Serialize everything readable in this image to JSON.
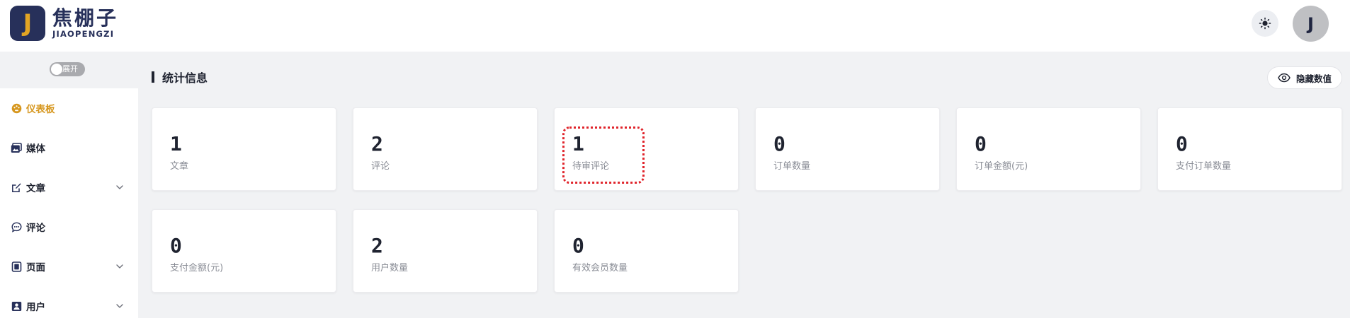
{
  "header": {
    "logo_letter": "J",
    "logo_cn": "焦棚子",
    "logo_en": "JIAOPENGZI",
    "avatar_letter": "J"
  },
  "sidebar": {
    "toggle_label": "展开",
    "items": [
      {
        "label": "仪表板",
        "icon": "dashboard-icon",
        "active": true,
        "expandable": false
      },
      {
        "label": "媒体",
        "icon": "image-icon",
        "active": false,
        "expandable": false
      },
      {
        "label": "文章",
        "icon": "edit-icon",
        "active": false,
        "expandable": true
      },
      {
        "label": "评论",
        "icon": "comment-icon",
        "active": false,
        "expandable": false
      },
      {
        "label": "页面",
        "icon": "page-icon",
        "active": false,
        "expandable": true
      },
      {
        "label": "用户",
        "icon": "user-icon",
        "active": false,
        "expandable": true
      }
    ]
  },
  "main": {
    "section_title": "统计信息",
    "hide_button_label": "隐藏数值",
    "stats": [
      {
        "value": "1",
        "label": "文章"
      },
      {
        "value": "2",
        "label": "评论"
      },
      {
        "value": "1",
        "label": "待审评论"
      },
      {
        "value": "0",
        "label": "订单数量"
      },
      {
        "value": "0",
        "label": "订单金额(元)"
      },
      {
        "value": "0",
        "label": "支付订单数量"
      },
      {
        "value": "0",
        "label": "支付金额(元)"
      },
      {
        "value": "2",
        "label": "用户数量"
      },
      {
        "value": "0",
        "label": "有效会员数量"
      }
    ]
  },
  "colors": {
    "brand": "#27305a",
    "accent": "#d6961d",
    "highlight": "#e0242b",
    "background": "#f1f2f4"
  }
}
